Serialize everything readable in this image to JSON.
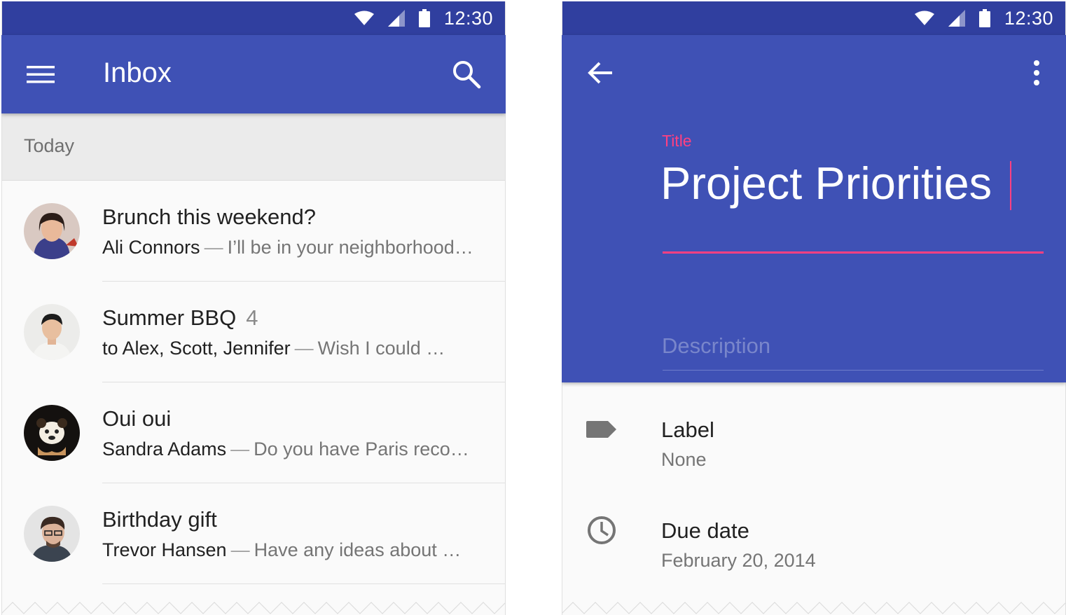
{
  "colors": {
    "primary": "#3f51b5",
    "primary_dark": "#303f9f",
    "accent": "#ff4081",
    "background": "#fafafa"
  },
  "inbox_screen": {
    "status_bar": {
      "time": "12:30",
      "icons": [
        "wifi-icon",
        "signal-icon",
        "battery-icon"
      ]
    },
    "app_bar": {
      "title": "Inbox",
      "nav_icon": "menu-icon",
      "action_icon": "search-icon"
    },
    "section_header": "Today",
    "messages": [
      {
        "subject": "Brunch this weekend?",
        "count": "",
        "sender": "Ali Connors",
        "separator": "—",
        "preview": "I’ll be in your neighborhood…"
      },
      {
        "subject": "Summer BBQ",
        "count": "4",
        "sender": "to Alex, Scott, Jennifer",
        "separator": "—",
        "preview": "Wish I could …"
      },
      {
        "subject": "Oui oui",
        "count": "",
        "sender": "Sandra Adams",
        "separator": "—",
        "preview": "Do you have Paris reco…"
      },
      {
        "subject": "Birthday gift",
        "count": "",
        "sender": "Trevor Hansen",
        "separator": "—",
        "preview": "Have any ideas about …"
      }
    ]
  },
  "edit_screen": {
    "status_bar": {
      "time": "12:30",
      "icons": [
        "wifi-icon",
        "signal-icon",
        "battery-icon"
      ]
    },
    "nav_icon": "arrow-back-icon",
    "action_icon": "more-vert-icon",
    "title_field": {
      "label": "Title",
      "value": "Project Priorities"
    },
    "description_field": {
      "placeholder": "Description"
    },
    "details": [
      {
        "icon": "label-icon",
        "label": "Label",
        "value": "None"
      },
      {
        "icon": "clock-icon",
        "label": "Due date",
        "value": "February 20, 2014"
      }
    ]
  }
}
